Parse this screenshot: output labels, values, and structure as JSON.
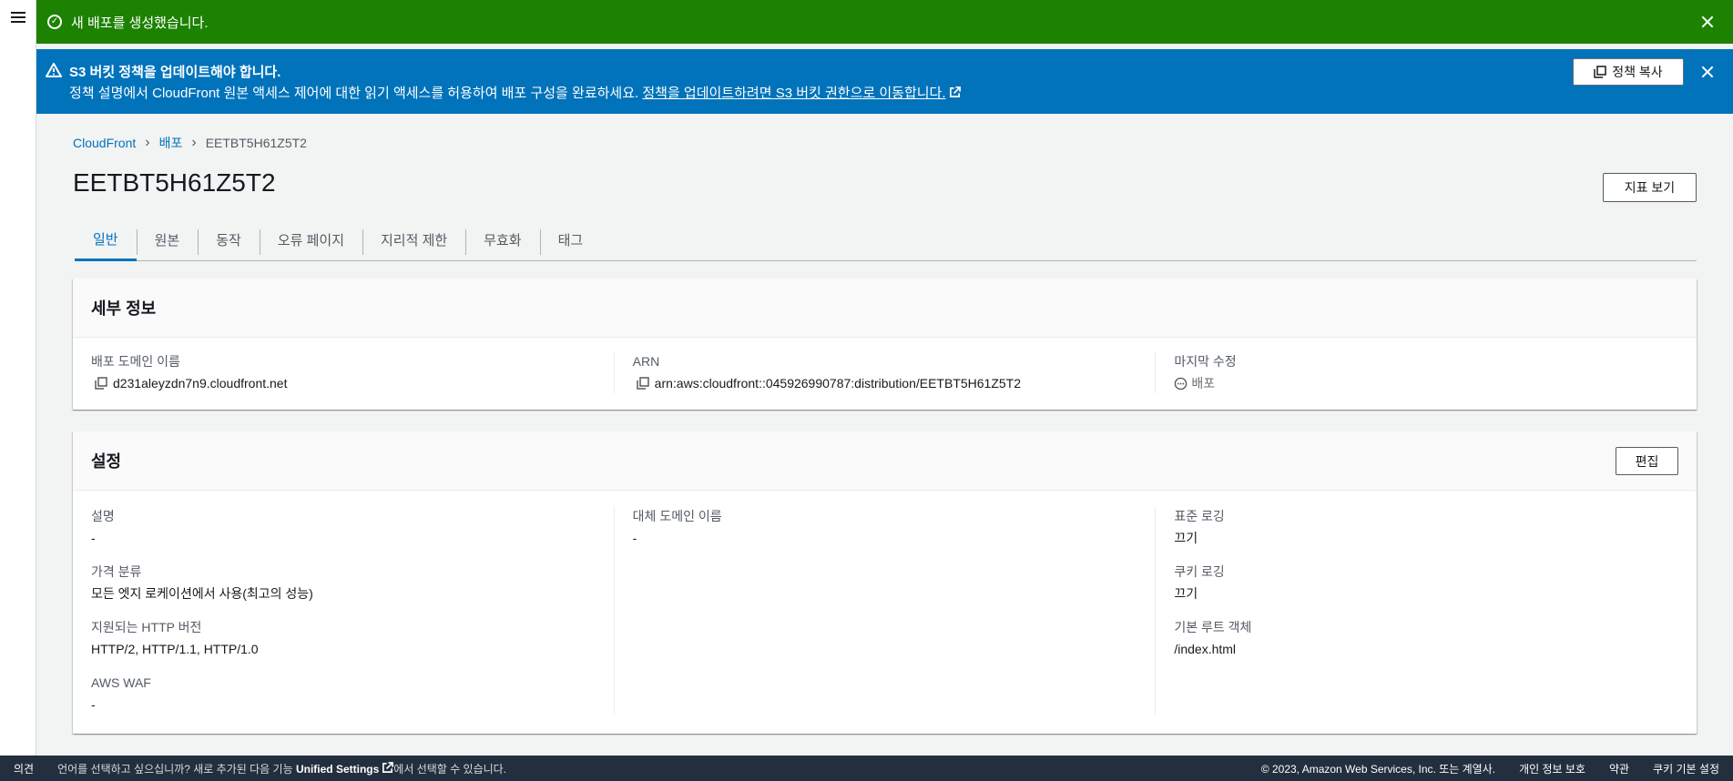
{
  "flash_success": {
    "message": "새 배포를 생성했습니다."
  },
  "flash_info": {
    "title": "S3 버킷 정책을 업데이트해야 합니다.",
    "body": "정책 설명에서 CloudFront 원본 액세스 제어에 대한 읽기 액세스를 허용하여 배포 구성을 완료하세요. ",
    "link": "정책을 업데이트하려면 S3 버킷 권한으로 이동합니다.",
    "copy_button": "정책 복사"
  },
  "breadcrumb": {
    "root": "CloudFront",
    "section": "배포",
    "current": "EETBT5H61Z5T2"
  },
  "page_title": "EETBT5H61Z5T2",
  "metrics_button": "지표 보기",
  "tabs": [
    "일반",
    "원본",
    "동작",
    "오류 페이지",
    "지리적 제한",
    "무효화",
    "태그"
  ],
  "details": {
    "title": "세부 정보",
    "domain_label": "배포 도메인 이름",
    "domain_value": "d231aleyzdn7n9.cloudfront.net",
    "arn_label": "ARN",
    "arn_value": "arn:aws:cloudfront::045926990787:distribution/EETBT5H61Z5T2",
    "modified_label": "마지막 수정",
    "modified_value": "배포"
  },
  "settings": {
    "title": "설정",
    "edit_button": "편집",
    "description_label": "설명",
    "description_value": "-",
    "price_class_label": "가격 분류",
    "price_class_value": "모든 엣지 로케이션에서 사용(최고의 성능)",
    "http_label": "지원되는 HTTP 버전",
    "http_value": "HTTP/2, HTTP/1.1, HTTP/1.0",
    "waf_label": "AWS WAF",
    "waf_value": "-",
    "alt_domain_label": "대체 도메인 이름",
    "alt_domain_value": "-",
    "std_logging_label": "표준 로깅",
    "std_logging_value": "끄기",
    "cookie_logging_label": "쿠키 로깅",
    "cookie_logging_value": "끄기",
    "root_object_label": "기본 루트 객체",
    "root_object_value": "/index.html"
  },
  "footer": {
    "feedback": "의견",
    "lang_msg_pre": "언어를 선택하고 싶으십니까? 새로 추가된 다음 기능 ",
    "lang_msg_bold": "Unified Settings",
    "lang_msg_post": "에서 선택할 수 있습니다.",
    "copyright": "© 2023, Amazon Web Services, Inc. 또는 계열사.",
    "privacy": "개인 정보 보호",
    "terms": "약관",
    "cookies": "쿠키 기본 설정"
  },
  "colors": {
    "success": "#1d8102",
    "info": "#0073bb",
    "footer": "#232f3e",
    "link": "#0073bb"
  }
}
